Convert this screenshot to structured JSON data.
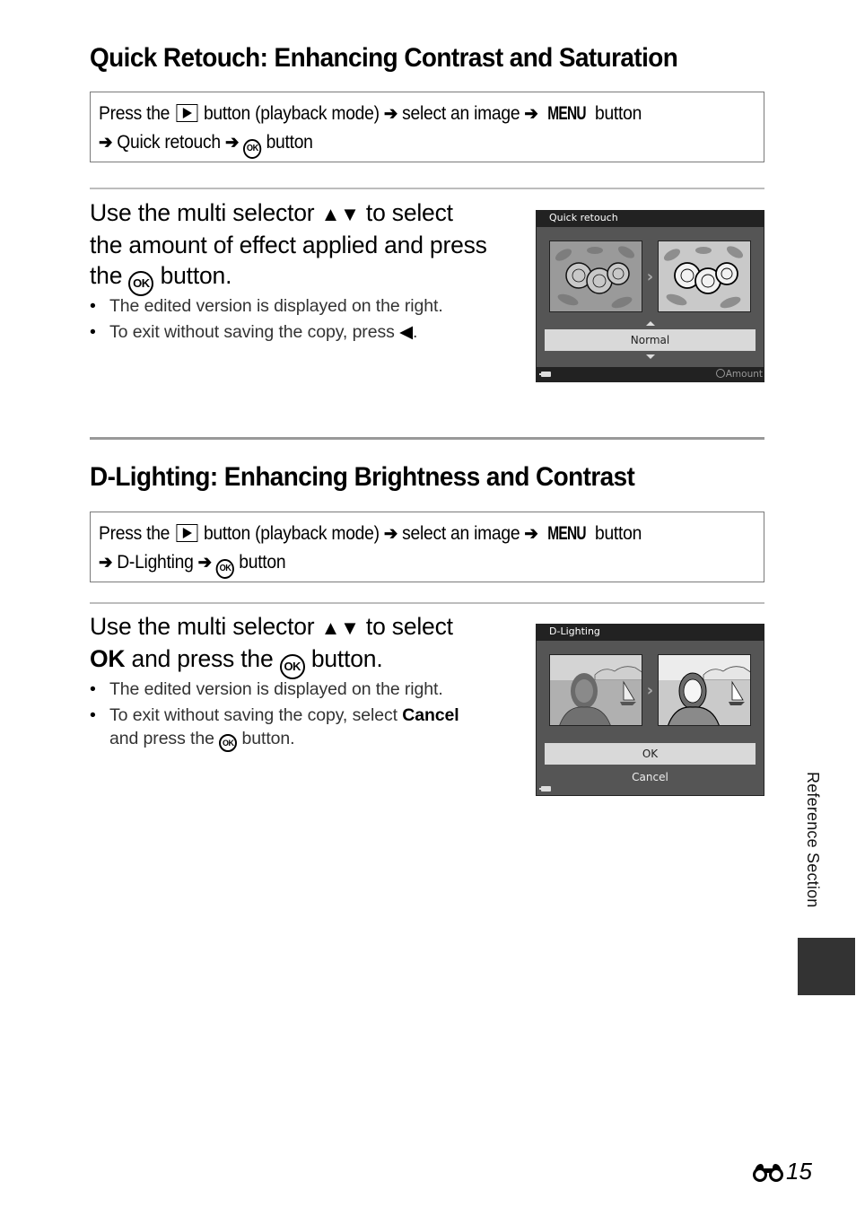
{
  "sections": [
    {
      "title": "Quick Retouch: Enhancing Contrast and Saturation",
      "nav": {
        "line1": {
          "prefix": "Press the",
          "after_play": "button (playback mode)",
          "select": "select an image",
          "menu": "MENU",
          "menu_after": "button"
        },
        "line2": {
          "item": "Quick retouch",
          "ok": "OK",
          "ok_after": "button"
        }
      },
      "step": {
        "line1_a": "Use the multi selector",
        "updown": "▲▼",
        "line1_b": "to select",
        "line2": "the amount of effect applied and press",
        "line3_a": "the",
        "ok": "OK",
        "line3_b": "button."
      },
      "bullets": [
        "The edited version is displayed on the right.",
        "To exit without saving the copy, press"
      ],
      "left_arrow": "◀",
      "screen": {
        "title": "Quick retouch",
        "selected_option": "Normal",
        "footer_hint": "Amount"
      }
    },
    {
      "title": "D-Lighting: Enhancing Brightness and Contrast",
      "nav": {
        "line1": {
          "prefix": "Press the",
          "after_play": "button (playback mode)",
          "select": "select an image",
          "menu": "MENU",
          "menu_after": "button"
        },
        "line2": {
          "item": "D-Lighting",
          "ok": "OK",
          "ok_after": "button"
        }
      },
      "step": {
        "line1_a": "Use the multi selector",
        "updown": "▲▼",
        "line1_b": "to select",
        "line2_bold": "OK",
        "line2_a": "and press the",
        "ok": "OK",
        "line2_b": "button."
      },
      "bullets": [
        "The edited version is displayed on the right.",
        {
          "a": "To exit without saving the copy, select",
          "bold": "Cancel",
          "b": "and press the",
          "ok": "OK",
          "c": "button."
        }
      ],
      "screen": {
        "title": "D-Lighting",
        "options": [
          "OK",
          "Cancel"
        ],
        "selected": "OK"
      }
    }
  ],
  "arrow_glyph": "➔",
  "side_label": "Reference Section",
  "page_number": "15",
  "colors": {
    "rule": "#bdbdbd",
    "side_tab": "#333333",
    "screen_bg": "#555555",
    "screen_title_bg": "#222222",
    "option_highlight": "#d9d9d9"
  }
}
